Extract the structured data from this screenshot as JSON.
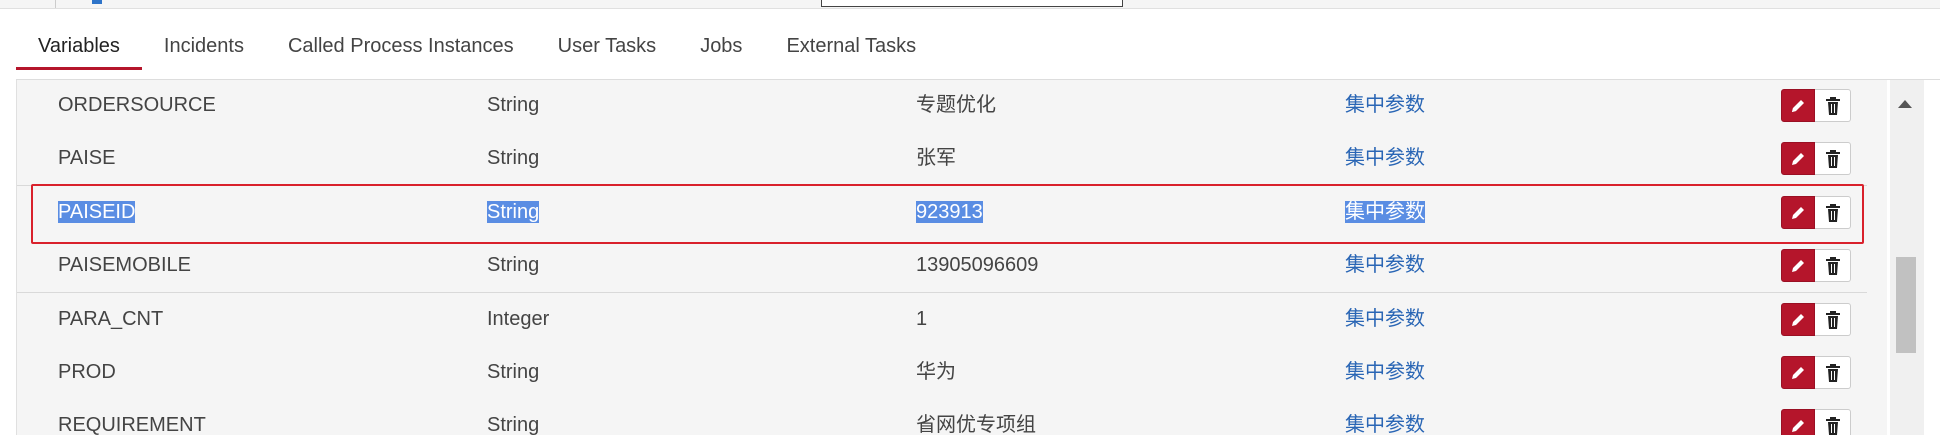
{
  "tabs": [
    {
      "label": "Variables",
      "active": true
    },
    {
      "label": "Incidents",
      "active": false
    },
    {
      "label": "Called Process Instances",
      "active": false
    },
    {
      "label": "User Tasks",
      "active": false
    },
    {
      "label": "Jobs",
      "active": false
    },
    {
      "label": "External Tasks",
      "active": false
    }
  ],
  "variables": [
    {
      "name": "ORDERSOURCE",
      "type": "String",
      "value": "专题优化",
      "scope": "集中参数"
    },
    {
      "name": "PAISE",
      "type": "String",
      "value": "张军",
      "scope": "集中参数"
    },
    {
      "name": "PAISEID",
      "type": "String",
      "value": "923913",
      "scope": "集中参数",
      "selected": true
    },
    {
      "name": "PAISEMOBILE",
      "type": "String",
      "value": "13905096609",
      "scope": "集中参数"
    },
    {
      "name": "PARA_CNT",
      "type": "Integer",
      "value": "1",
      "scope": "集中参数"
    },
    {
      "name": "PROD",
      "type": "String",
      "value": "华为",
      "scope": "集中参数"
    },
    {
      "name": "REQUIREMENT",
      "type": "String",
      "value": "省网优专项组",
      "scope": "集中参数"
    }
  ],
  "icons": {
    "edit": "pencil-icon",
    "delete": "trash-icon"
  },
  "colors": {
    "accent": "#b5152b",
    "link": "#2a66b5",
    "selection": "#5a8de3",
    "highlight": "#d9212c"
  }
}
